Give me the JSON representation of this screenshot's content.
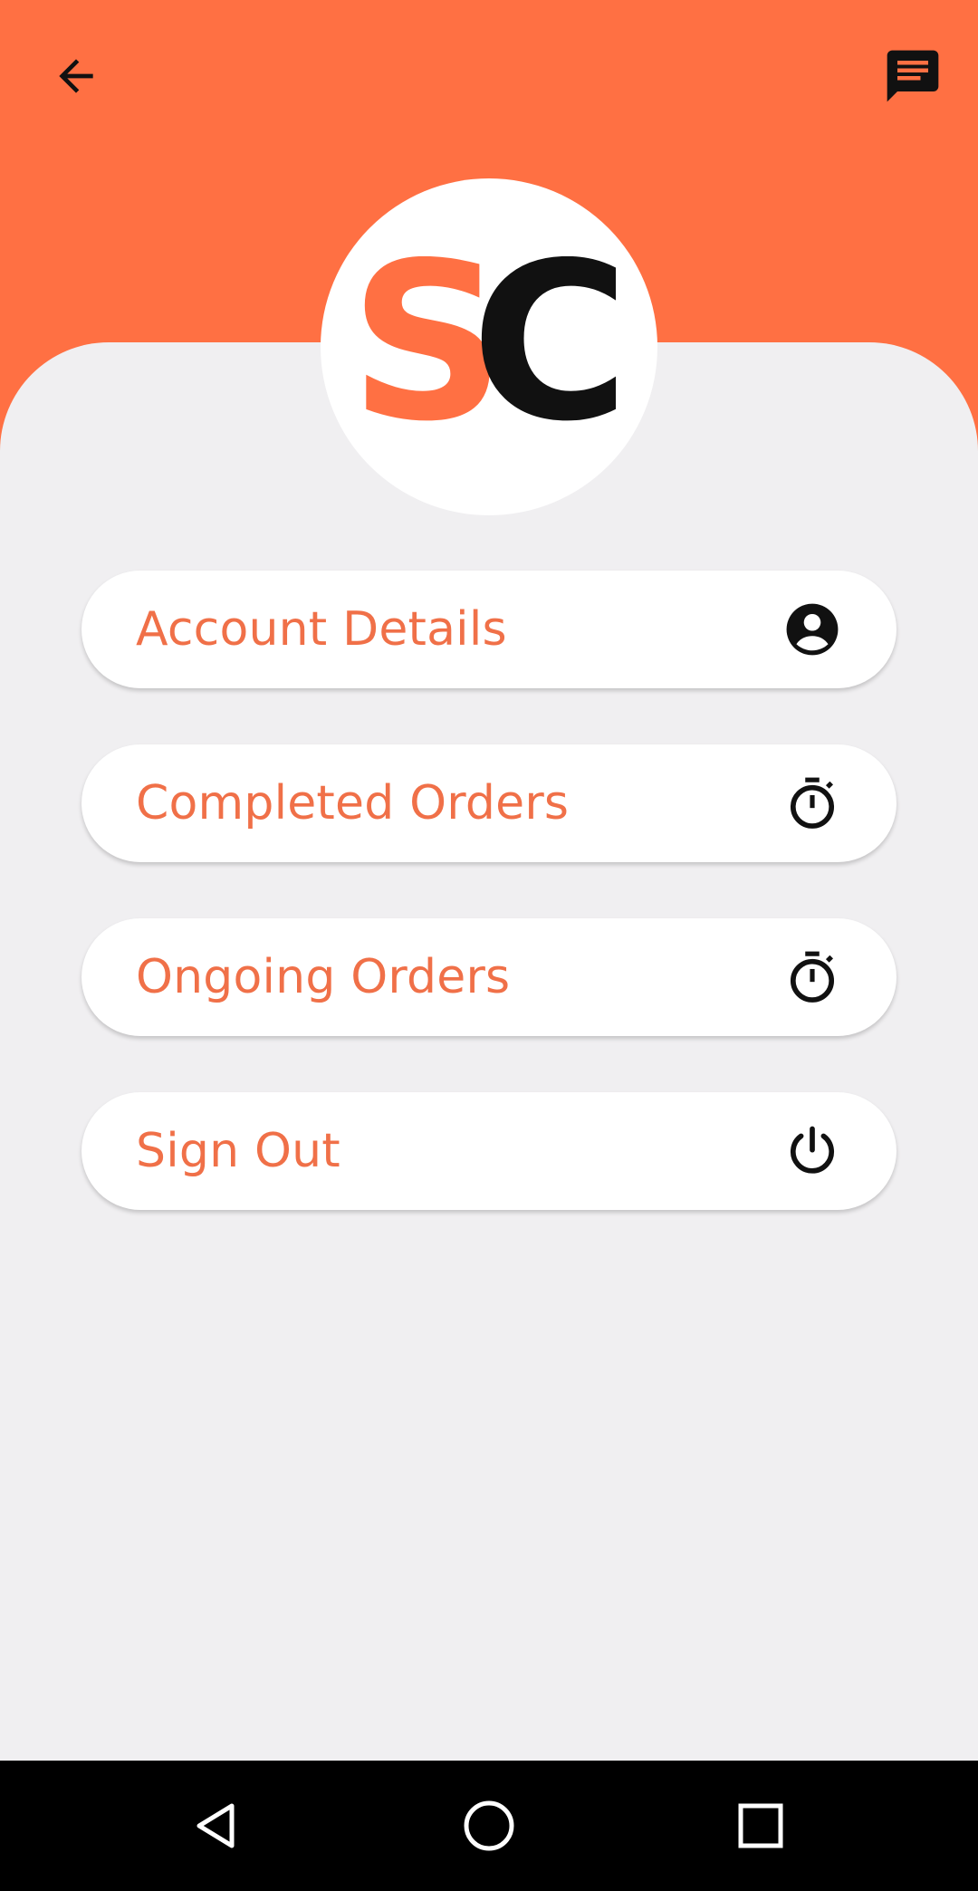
{
  "colors": {
    "accent": "#ff7043",
    "menu_text": "#f07048",
    "background": "#f0eff1",
    "card": "#ffffff",
    "nav_bar": "#000000"
  },
  "header": {
    "back_icon": "arrow-back-icon",
    "chat_icon": "chat-icon"
  },
  "logo": {
    "letters": [
      "S",
      "C"
    ],
    "colors": [
      "#ff7043",
      "#111111"
    ]
  },
  "menu": {
    "items": [
      {
        "label": "Account Details",
        "icon": "account-circle-icon"
      },
      {
        "label": "Completed Orders",
        "icon": "timer-icon"
      },
      {
        "label": "Ongoing Orders",
        "icon": "timer-icon"
      },
      {
        "label": "Sign Out",
        "icon": "power-icon"
      }
    ]
  },
  "nav": {
    "back_icon": "nav-back-triangle-icon",
    "home_icon": "nav-home-circle-icon",
    "recent_icon": "nav-recent-square-icon"
  }
}
